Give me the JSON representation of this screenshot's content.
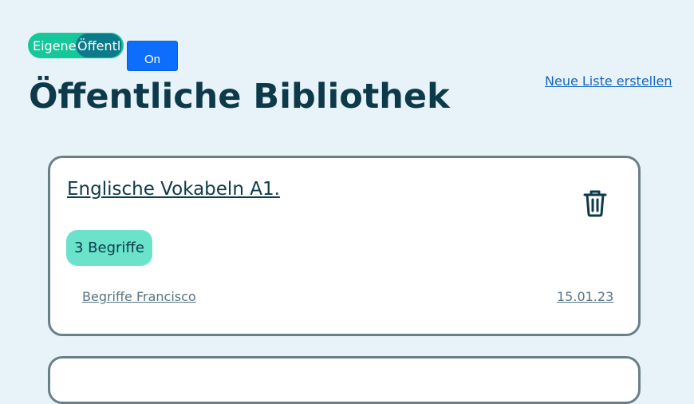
{
  "toggle": {
    "own_label": "Eigene",
    "public_label": "Öffentli",
    "selected": "public"
  },
  "on_button_label": "On",
  "page_title": "Öffentliche Bibliothek",
  "new_list_link": "Neue Liste erstellen",
  "cards": [
    {
      "title": "Englische Vokabeln A1.",
      "term_count_label": "3 Begriffe",
      "author_label": "Begriffe Francisco",
      "date": "15.01.23",
      "delete_icon": "trash-icon"
    }
  ],
  "colors": {
    "background": "#e7f3f9",
    "accent_green": "#16c79a",
    "badge_green": "#6be3cb",
    "primary_blue": "#0d6efd",
    "link_blue": "#1565c0",
    "dark_text": "#0d3a4a"
  }
}
